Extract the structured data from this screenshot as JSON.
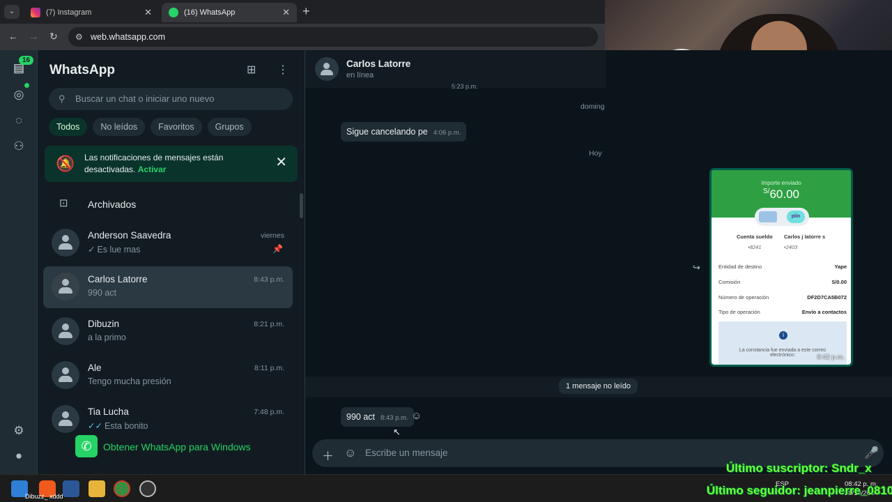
{
  "browser": {
    "tabs": [
      {
        "label": "(7) Instagram",
        "active": false
      },
      {
        "label": "(16) WhatsApp",
        "active": true
      }
    ],
    "url": "web.whatsapp.com"
  },
  "rail": {
    "unread_badge": "16"
  },
  "sidebar": {
    "title": "WhatsApp",
    "search_placeholder": "Buscar un chat o iniciar uno nuevo",
    "filters": [
      "Todos",
      "No leídos",
      "Favoritos",
      "Grupos"
    ],
    "notice": {
      "text": "Las notificaciones de mensajes están desactivadas.",
      "action": "Activar"
    },
    "archived_label": "Archivados",
    "chats": [
      {
        "name": "Anderson Saavedra",
        "preview": "Es lue mas",
        "time": "viernes",
        "tick": "✓",
        "tick_color": "gray",
        "pinned": true
      },
      {
        "name": "Carlos Latorre",
        "preview": "990 act",
        "time": "8:43 p.m.",
        "tick": "",
        "selected": true
      },
      {
        "name": "Dibuzin",
        "preview": "a la primo",
        "time": "8:21 p.m.",
        "tick": ""
      },
      {
        "name": "Ale",
        "preview": "Tengo mucha presión",
        "time": "8:11 p.m.",
        "tick": ""
      },
      {
        "name": "Tia Lucha",
        "preview": "Esta bonito",
        "time": "7:48 p.m.",
        "tick": "✓✓",
        "tick_color": "blue"
      }
    ],
    "get_app": "Obtener WhatsApp para Windows"
  },
  "conversation": {
    "contact_name": "Carlos Latorre",
    "status": "en línea",
    "partial_time": "5:23 p.m.",
    "date_labels": [
      "doming",
      "Hoy"
    ],
    "messages": [
      {
        "text": "Sigue cancelando pe",
        "time": "4:06 p.m."
      },
      {
        "text": "990 act",
        "time": "8:43 p.m."
      }
    ],
    "unread_separator": "1 mensaje no leído",
    "composer_placeholder": "Escribe un mensaje",
    "receipt": {
      "label": "Importe enviado",
      "currency": "S/",
      "amount": "60.00",
      "from_name": "Cuenta sueldo",
      "from_digits": "•8241",
      "to_name": "Carlos j latorre s",
      "to_digits": "•2403",
      "app_chip": "plin",
      "rows": [
        {
          "label": "Entidad de destino",
          "value": "Yape"
        },
        {
          "label": "Comisión",
          "value": "S/0.00"
        },
        {
          "label": "Número de operación",
          "value": "DF2D7CA5B072"
        },
        {
          "label": "Tipo de operación",
          "value": "Envío a contactos"
        }
      ],
      "info": "La constancia fue enviada a este correo electrónico:",
      "time": "8:42 p.m."
    }
  },
  "stream_overlay": {
    "subscriber": "Último suscriptor: Sndr_x",
    "follower": "Último seguidor: jeanpierre_0810"
  },
  "taskbar": {
    "item_label": "Dibuzz_ xddd",
    "language": "ESP",
    "time": "08:42 p. m.",
    "date": "28/10/2024"
  }
}
